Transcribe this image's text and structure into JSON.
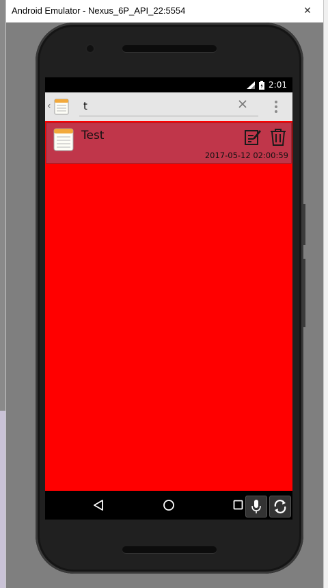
{
  "window": {
    "title": "Android Emulator - Nexus_6P_API_22:5554",
    "close_label": "✕"
  },
  "status_bar": {
    "time": "2:01"
  },
  "action_bar": {
    "search_value": "t"
  },
  "notes": [
    {
      "title": "Test",
      "timestamp": "2017-05-12 02:00:59"
    }
  ],
  "icons": {
    "app": "notepad-icon",
    "clear": "close-icon",
    "overflow": "more-vert-icon",
    "note": "notepad-icon",
    "edit": "edit-note-icon",
    "delete": "trash-icon",
    "nav_back": "back-triangle-icon",
    "nav_home": "home-circle-icon",
    "nav_recent": "recent-square-icon",
    "emu_mic": "microphone-icon",
    "emu_rotate": "rotate-icon"
  },
  "colors": {
    "content_bg": "#ff0000",
    "note_row_bg": "#c0364a",
    "action_bar_bg": "#e6e6e6"
  }
}
